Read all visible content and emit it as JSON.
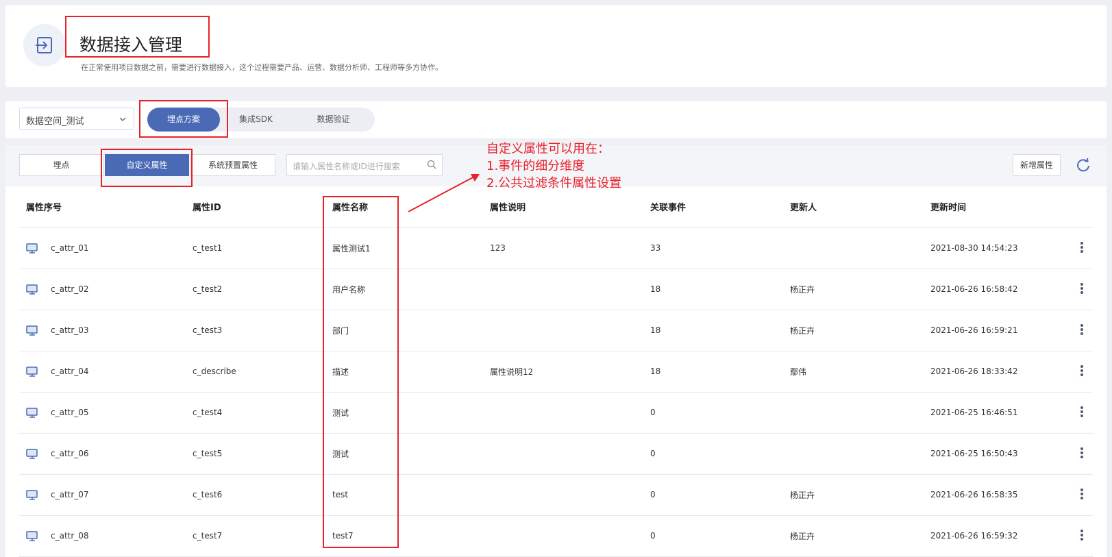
{
  "header": {
    "title": "数据接入管理",
    "description": "在正常使用项目数据之前，需要进行数据接入，这个过程需要产品、运营、数据分析师、工程师等多方协作。"
  },
  "toolbar": {
    "space_select": "数据空间_测试",
    "tabs": [
      "埋点方案",
      "集成SDK",
      "数据验证"
    ]
  },
  "subtabs": [
    "埋点",
    "自定义属性",
    "系统预置属性"
  ],
  "search": {
    "placeholder": "请输入属性名称或ID进行搜索"
  },
  "add_button": "新增属性",
  "annotation": {
    "line1": "自定义属性可以用在：",
    "line2": "1.事件的细分维度",
    "line3": "2.公共过滤条件属性设置"
  },
  "table": {
    "headers": [
      "属性序号",
      "属性ID",
      "属性名称",
      "属性说明",
      "关联事件",
      "更新人",
      "更新时间"
    ],
    "rows": [
      [
        "c_attr_01",
        "c_test1",
        "属性测试1",
        "123",
        "33",
        "",
        "2021-08-30 14:54:23"
      ],
      [
        "c_attr_02",
        "c_test2",
        "用户名称",
        "",
        "18",
        "杨正卉",
        "2021-06-26 16:58:42"
      ],
      [
        "c_attr_03",
        "c_test3",
        "部门",
        "",
        "18",
        "杨正卉",
        "2021-06-26 16:59:21"
      ],
      [
        "c_attr_04",
        "c_describe",
        "描述",
        "属性说明12",
        "18",
        "鄢伟",
        "2021-06-26 18:33:42"
      ],
      [
        "c_attr_05",
        "c_test4",
        "测试",
        "",
        "0",
        "",
        "2021-06-25 16:46:51"
      ],
      [
        "c_attr_06",
        "c_test5",
        "测试",
        "",
        "0",
        "",
        "2021-06-25 16:50:43"
      ],
      [
        "c_attr_07",
        "c_test6",
        "test",
        "",
        "0",
        "杨正卉",
        "2021-06-26 16:58:35"
      ],
      [
        "c_attr_08",
        "c_test7",
        "test7",
        "",
        "0",
        "杨正卉",
        "2021-06-26 16:59:32"
      ]
    ]
  },
  "colors": {
    "primary": "#4a6ab6",
    "annotation_red": "#e8202a"
  }
}
